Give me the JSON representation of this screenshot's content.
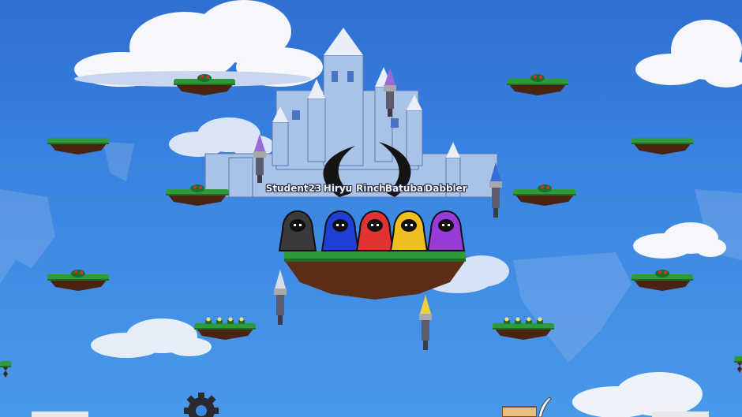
{
  "colors": {
    "sky_top": "#2f6fd2",
    "sky_bottom": "#4a98ea",
    "grass": "#2e9a3a",
    "dirt": "#5a2d14",
    "castle": "#a9c2e8"
  },
  "players": [
    {
      "name": "Student23",
      "color": "#3a3a3a"
    },
    {
      "name": "Hiryu",
      "color": "#1f3fd4"
    },
    {
      "name": "Rinchi",
      "color": "#e23232"
    },
    {
      "name": "Batubar",
      "color": "#f0c020"
    },
    {
      "name": "Dabbler",
      "color": "#9a3ad8"
    }
  ],
  "flame_colors": [
    "#9a6ad8",
    "#9a6ad8",
    "#d8dce8",
    "#3a6ad8",
    "#f0d040"
  ],
  "hud": {
    "settings_icon": "gear-icon",
    "scroll_icon": "scroll-icon",
    "quill_icon": "quill-icon"
  }
}
